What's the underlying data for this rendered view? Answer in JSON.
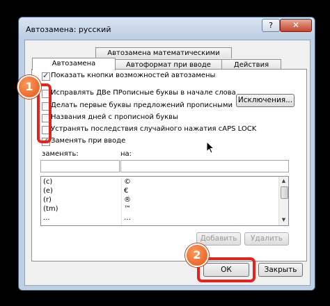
{
  "window": {
    "title": "Автозамена: русский",
    "help_label": "?",
    "close_label": "✕"
  },
  "tabs": {
    "top_row": [
      "Автозамена математическими символами"
    ],
    "bottom_row": [
      "Автозамена",
      "Автоформат при вводе",
      "Действия"
    ],
    "active": "Автозамена"
  },
  "options": {
    "show_buttons": {
      "label": "Показать кнопки возможностей автозамены",
      "checked": true
    },
    "fix_two_caps": {
      "label": "Исправлять ДВе ПРописные буквы в начале слова",
      "checked": false
    },
    "capitalize_sentences": {
      "label": "Делать первые буквы предложений прописными",
      "checked": false
    },
    "capitalize_days": {
      "label": "Названия дней с прописной буквы",
      "checked": false
    },
    "fix_caps_lock": {
      "label": "Устранять последствия случайного нажатия cAPS LOCK",
      "checked": false
    },
    "replace_while_typing": {
      "label": "Заменять при вводе",
      "checked": true
    }
  },
  "exceptions_button": "Исключения...",
  "replace": {
    "replace_label": "заменять:",
    "with_label": "на:",
    "replace_value": "",
    "with_value": ""
  },
  "table": {
    "rows": [
      {
        "from": "(c)",
        "to": "©"
      },
      {
        "from": "(e)",
        "to": "€"
      },
      {
        "from": "(r)",
        "to": "®"
      },
      {
        "from": "(tm)",
        "to": "™"
      },
      {
        "from": "...",
        "to": "…"
      }
    ],
    "scroll_up": "▲",
    "scroll_down": "▼"
  },
  "buttons": {
    "add": "Добавить",
    "delete": "Удалить",
    "ok": "ОК",
    "close": "Закрыть"
  },
  "annotations": {
    "badge1": "1",
    "badge2": "2",
    "color": "#e0241e"
  }
}
